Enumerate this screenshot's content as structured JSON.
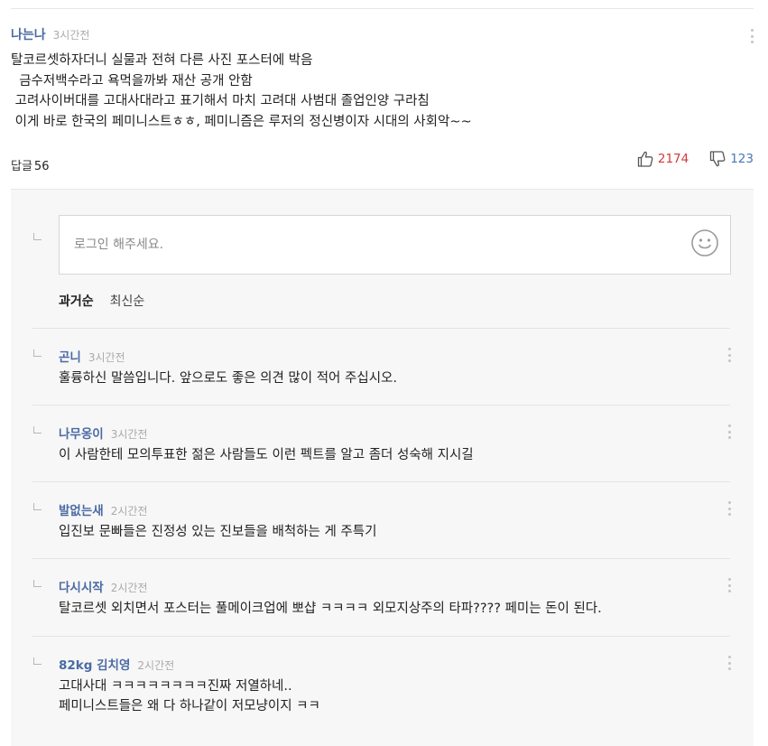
{
  "comment": {
    "author": "나는나",
    "time": "3시간전",
    "lines": [
      "탈코르셋하자더니 실물과 전혀 다른 사진 포스터에 박음",
      "  금수저백수라고 욕먹을까봐 재산 공개 안함",
      " 고려사이버대를 고대사대라고 표기해서 마치 고려대 사범대 졸업인양 구라침",
      " 이게 바로 한국의 페미니스트ㅎㅎ, 페미니즘은 루저의 정신병이자 시대의 사회악~~"
    ],
    "reply_label": "답글",
    "reply_count": "56",
    "likes": "2174",
    "dislikes": "123"
  },
  "reply_input": {
    "placeholder": "로그인 해주세요."
  },
  "sort": {
    "oldest": "과거순",
    "newest": "최신순"
  },
  "replies": [
    {
      "author": "곤니",
      "time": "3시간전",
      "text": "훌륭하신 말씀입니다. 앞으로도 좋은 의견 많이 적어 주십시오."
    },
    {
      "author": "나무옹이",
      "time": "3시간전",
      "text": "이 사람한테 모의투표한 젊은 사람들도 이런 펙트를 알고 좀더 성숙해 지시길"
    },
    {
      "author": "발없는새",
      "time": "2시간전",
      "text": "입진보 문빠들은 진정성 있는 진보들을 배척하는 게 주특기"
    },
    {
      "author": "다시시작",
      "time": "2시간전",
      "text": "탈코르셋 외치면서 포스터는 풀메이크업에 뽀샵 ㅋㅋㅋㅋ 외모지상주의 타파???? 페미는 돈이 된다."
    },
    {
      "author": "82kg 김치영",
      "time": "2시간전",
      "text": "고대사대 ㅋㅋㅋㅋㅋㅋㅋㅋ진짜 저열하네..\n페미니스트들은 왜 다 하나같이 저모냥이지 ㅋㅋ"
    }
  ],
  "icons": {
    "like": "thumbs-up-icon",
    "dislike": "thumbs-down-icon",
    "menu": "more-vertical-icon",
    "emoji": "emoji-smile-icon",
    "reply_corner": "reply-corner-icon"
  },
  "colors": {
    "author": "#4a6aa5",
    "like_count": "#d13b3b",
    "dislike_count": "#4a76b8",
    "reply_bg": "#f7f7f7"
  }
}
